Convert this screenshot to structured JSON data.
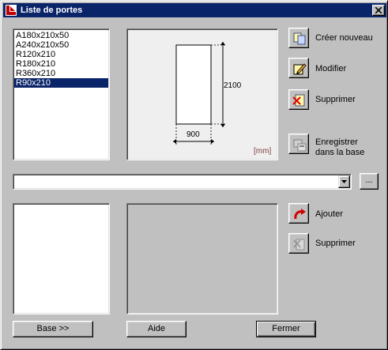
{
  "window": {
    "title": "Liste de portes",
    "close_symbol": "×"
  },
  "door_list": {
    "items": [
      "A180x210x50",
      "A240x210x50",
      "R120x210",
      "R180x210",
      "R360x210",
      "R90x210"
    ],
    "selected_index": 5
  },
  "preview": {
    "width_value": "900",
    "height_value": "2100",
    "unit": "[mm]"
  },
  "actions": {
    "create_new": "Créer nouveau",
    "modify": "Modifier",
    "delete": "Supprimer",
    "save_line1": "Enregistrer",
    "save_line2": "dans la base"
  },
  "combo": {
    "value": "",
    "browse_label": "..."
  },
  "lower_actions": {
    "add": "Ajouter",
    "delete": "Supprimer"
  },
  "footer": {
    "base_label": "Base >>",
    "help_label": "Aide",
    "close_label": "Fermer"
  }
}
